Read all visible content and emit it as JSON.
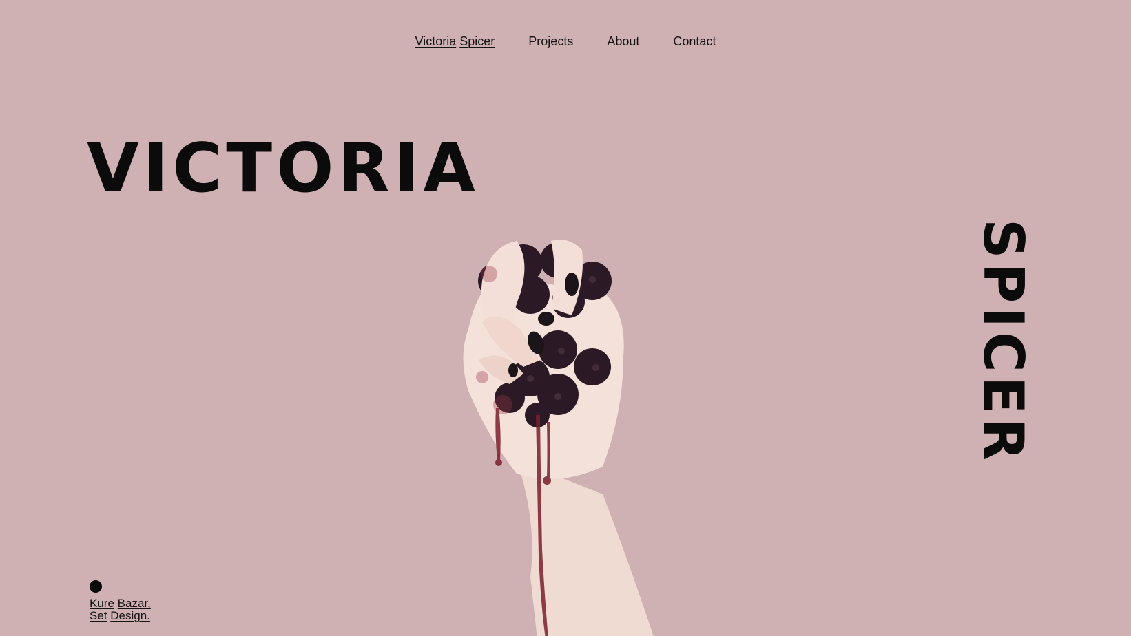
{
  "page": {
    "background": "#cfb0b3"
  },
  "nav": {
    "brand_first": "Victoria",
    "brand_last": "Spicer",
    "projects": "Projects",
    "about": "About",
    "contact": "Contact"
  },
  "hero": {
    "left_word": "VICTORIA",
    "right_word": "SPICER",
    "image_alt_icon": "hand-with-blackberries-icon"
  },
  "caption": {
    "line1_a": "Kure",
    "line1_b": "Bazar,",
    "line2_a": "Set",
    "line2_b": "Design."
  },
  "colors": {
    "text": "#141414",
    "berry": "#2b1a25",
    "skin": "#f3dfd7",
    "juice": "#7a1f2b"
  }
}
